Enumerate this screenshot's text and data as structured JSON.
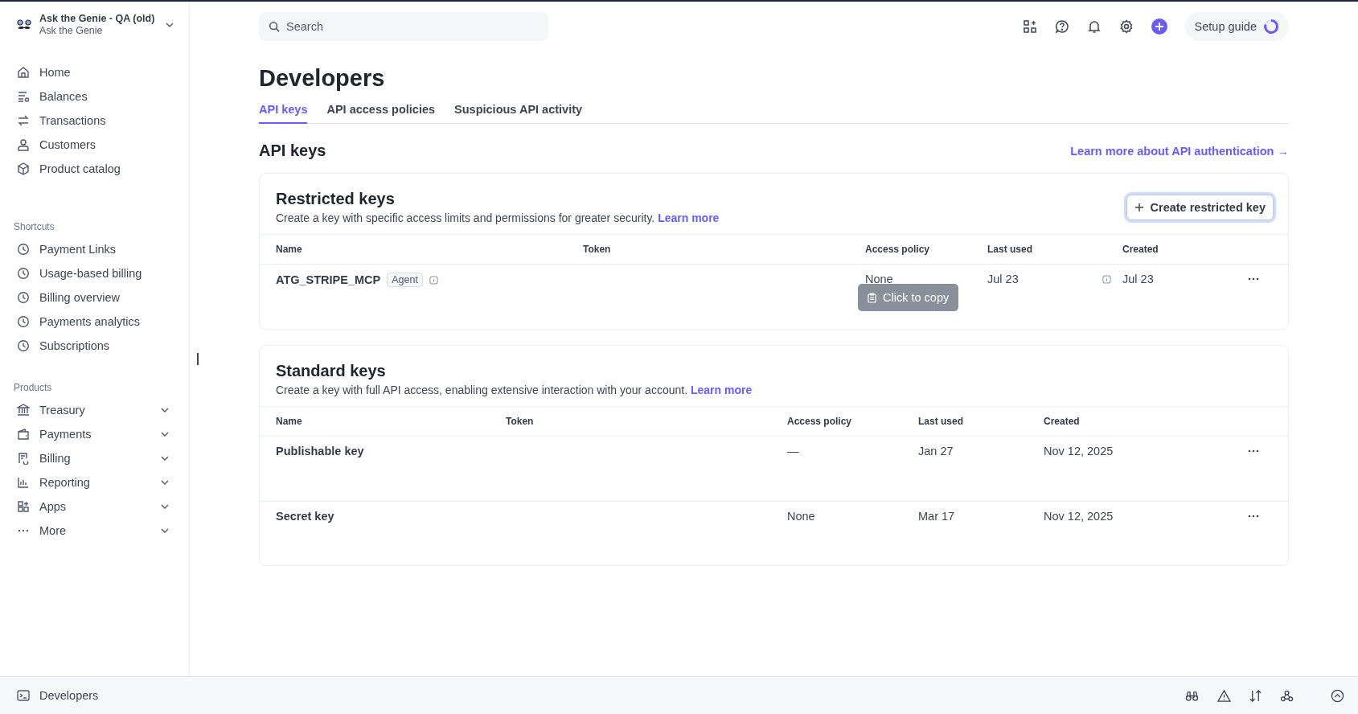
{
  "account": {
    "name": "Ask the Genie - QA (old)",
    "subtitle": "Ask the Genie"
  },
  "sidebar": {
    "items": [
      {
        "label": "Home"
      },
      {
        "label": "Balances"
      },
      {
        "label": "Transactions"
      },
      {
        "label": "Customers"
      },
      {
        "label": "Product catalog"
      }
    ],
    "shortcuts": {
      "heading": "Shortcuts",
      "items": [
        {
          "label": "Payment Links"
        },
        {
          "label": "Usage-based billing"
        },
        {
          "label": "Billing overview"
        },
        {
          "label": "Payments analytics"
        },
        {
          "label": "Subscriptions"
        }
      ]
    },
    "products": {
      "heading": "Products",
      "items": [
        {
          "label": "Treasury",
          "expanded": false
        },
        {
          "label": "Payments",
          "expanded": false
        },
        {
          "label": "Billing",
          "expanded": false
        },
        {
          "label": "Reporting",
          "expanded": false
        },
        {
          "label": "Apps",
          "expanded": false
        },
        {
          "label": "More",
          "expanded": false
        }
      ]
    }
  },
  "search": {
    "placeholder": "Search"
  },
  "setup_guide": "Setup guide",
  "page_title": "Developers",
  "tabs": [
    {
      "label": "API keys",
      "selected": true
    },
    {
      "label": "API access policies",
      "selected": false
    },
    {
      "label": "Suspicious API activity",
      "selected": false
    }
  ],
  "section": {
    "title": "API keys",
    "link": "Learn more about API authentication →"
  },
  "restricted_keys": {
    "title": "Restricted keys",
    "description": "Create a key with specific access limits and permissions for greater security.",
    "learn_more": "Learn more",
    "create_button": "Create restricted key",
    "columns": [
      "Name",
      "Token",
      "Access policy",
      "Last used",
      "Created"
    ],
    "rows": [
      {
        "name": "ATG_STRIPE_MCP",
        "badge": "Agent",
        "access_policy": "None",
        "last_used": "Jul 23",
        "created": "Jul 23"
      }
    ],
    "tooltip": "Click to copy"
  },
  "standard_keys": {
    "title": "Standard keys",
    "description": "Create a key with full API access, enabling extensive interaction with your account.",
    "learn_more": "Learn more",
    "columns": [
      "Name",
      "Token",
      "Access policy",
      "Last used",
      "Created"
    ],
    "rows": [
      {
        "name": "Publishable key",
        "access_policy": "—",
        "last_used": "Jan 27",
        "created": "Nov 12, 2025"
      },
      {
        "name": "Secret key",
        "access_policy": "None",
        "last_used": "Mar 17",
        "created": "Nov 12, 2025"
      }
    ]
  },
  "bottom_bar": {
    "label": "Developers"
  }
}
